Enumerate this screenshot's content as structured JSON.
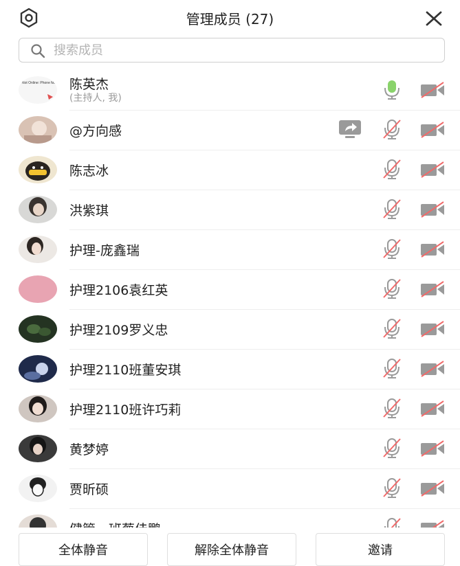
{
  "header": {
    "title": "管理成员 (27)",
    "settings_icon": "gear-icon",
    "close_icon": "close-icon"
  },
  "search": {
    "placeholder": "搜索成员",
    "value": ""
  },
  "colors": {
    "mic_active": "#8ad36b",
    "muted_red": "#f06a6a",
    "icon_gray": "#9a9a9a"
  },
  "avatar_badge_text": "Not Online: Phone Ma... When Necessar",
  "members": [
    {
      "name": "陈英杰",
      "sub": "(主持人, 我)",
      "mic": "on",
      "camera": "off"
    },
    {
      "name": "@方向感",
      "sub": "",
      "mic": "muted",
      "camera": "off",
      "sharing": true
    },
    {
      "name": "陈志冰",
      "sub": "",
      "mic": "muted",
      "camera": "off"
    },
    {
      "name": "洪紫琪",
      "sub": "",
      "mic": "muted",
      "camera": "off"
    },
    {
      "name": "护理-庞鑫瑞",
      "sub": "",
      "mic": "muted",
      "camera": "off"
    },
    {
      "name": "护理2106袁红英",
      "sub": "",
      "mic": "muted",
      "camera": "off"
    },
    {
      "name": "护理2109罗义忠",
      "sub": "",
      "mic": "muted",
      "camera": "off"
    },
    {
      "name": "护理2110班董安琪",
      "sub": "",
      "mic": "muted",
      "camera": "off"
    },
    {
      "name": "护理2110班许巧莉",
      "sub": "",
      "mic": "muted",
      "camera": "off"
    },
    {
      "name": "黄梦婷",
      "sub": "",
      "mic": "muted",
      "camera": "off"
    },
    {
      "name": "贾昕硕",
      "sub": "",
      "mic": "muted",
      "camera": "off"
    },
    {
      "name": "健管一班蔡佳鹏",
      "sub": "",
      "mic": "muted",
      "camera": "off"
    }
  ],
  "footer": {
    "mute_all": "全体静音",
    "unmute_all": "解除全体静音",
    "invite": "邀请"
  }
}
